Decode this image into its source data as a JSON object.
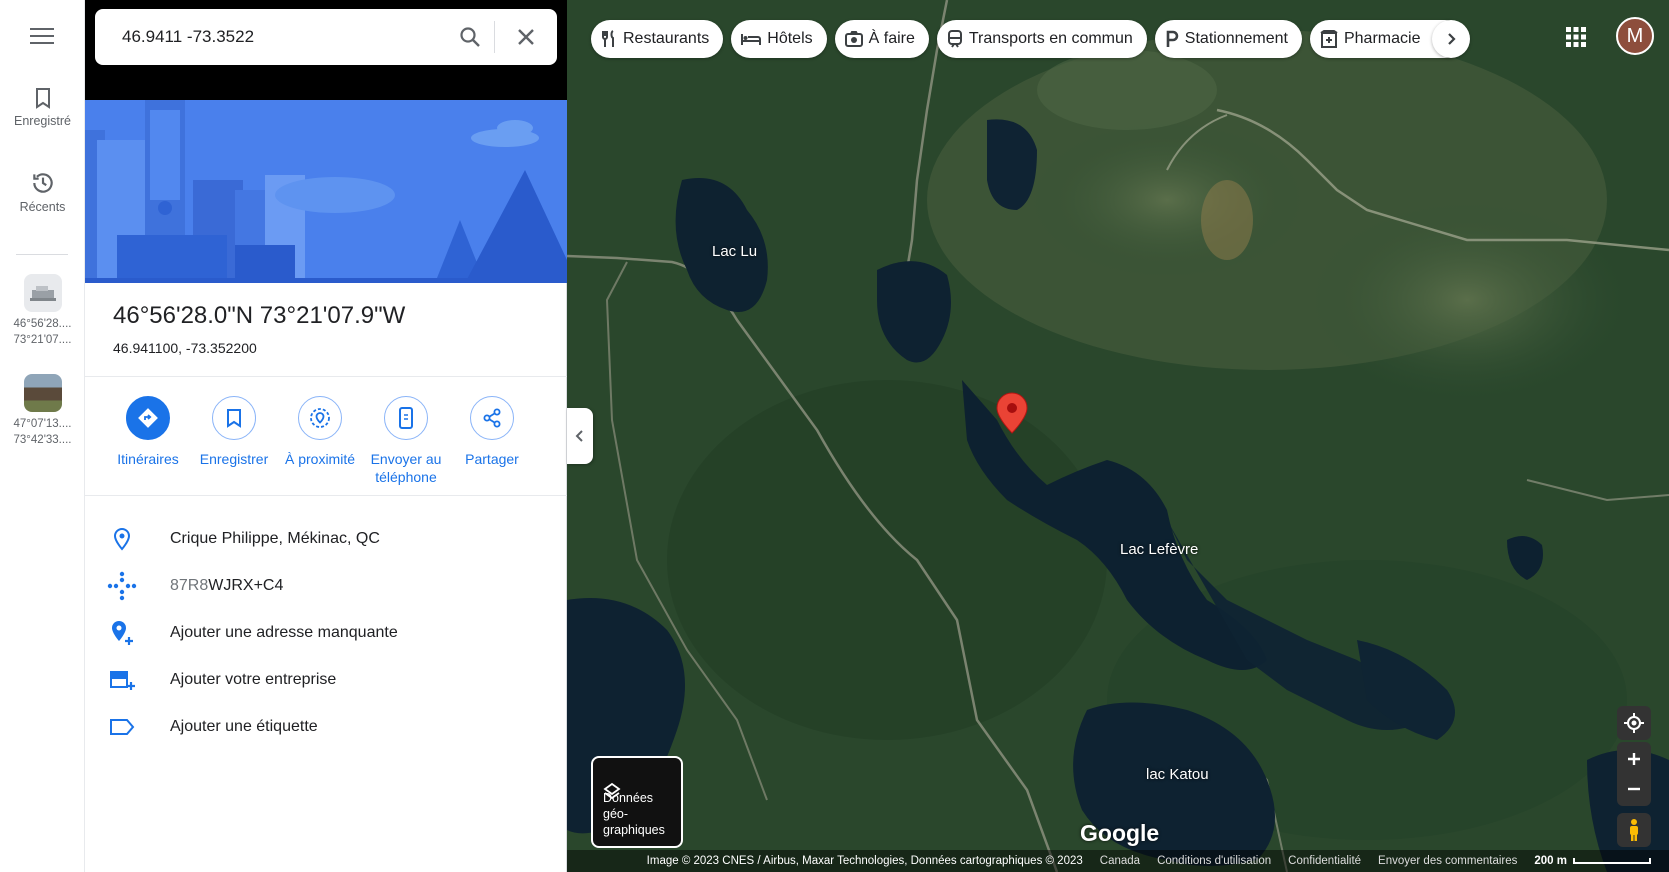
{
  "search": {
    "value": "46.9411 -73.3522"
  },
  "rail": {
    "saved_label": "Enregistré",
    "recents_label": "Récents",
    "recent_items": [
      {
        "line1": "46°56'28....",
        "line2": "73°21'07...."
      },
      {
        "line1": "47°07'13....",
        "line2": "73°42'33...."
      }
    ]
  },
  "place": {
    "coord_dms": "46°56'28.0\"N 73°21'07.9\"W",
    "coord_decimal": "46.941100, -73.352200"
  },
  "actions": [
    {
      "label": "Itinéraires",
      "icon": "directions-icon"
    },
    {
      "label": "Enregistrer",
      "icon": "bookmark-icon"
    },
    {
      "label": "À proximité",
      "icon": "nearby-icon"
    },
    {
      "label": "Envoyer au téléphone",
      "icon": "send-to-phone-icon"
    },
    {
      "label": "Partager",
      "icon": "share-icon"
    }
  ],
  "info": {
    "address": "Crique Philippe, Mékinac, QC",
    "pluscode_prefix": "87R8",
    "pluscode_rest": "WJRX+C4",
    "add_address": "Ajouter une adresse manquante",
    "add_business": "Ajouter votre entreprise",
    "add_label": "Ajouter une étiquette"
  },
  "chips": [
    "Restaurants",
    "Hôtels",
    "À faire",
    "Transports en commun",
    "Stationnement",
    "Pharmacie"
  ],
  "avatar_letter": "M",
  "map": {
    "labels": [
      "Lac Lu",
      "Lac Lefèvre",
      "lac Katou"
    ],
    "layers_label": "Données géo-graphiques",
    "brand": "Google",
    "attribution": "Image © 2023 CNES / Airbus, Maxar Technologies, Données cartographiques © 2023",
    "links": [
      "Canada",
      "Conditions d'utilisation",
      "Confidentialité",
      "Envoyer des commentaires"
    ],
    "scale": "200 m"
  },
  "colors": {
    "accent": "#1a73e8",
    "pin": "#ea4335",
    "hero": "#4a80ec"
  }
}
